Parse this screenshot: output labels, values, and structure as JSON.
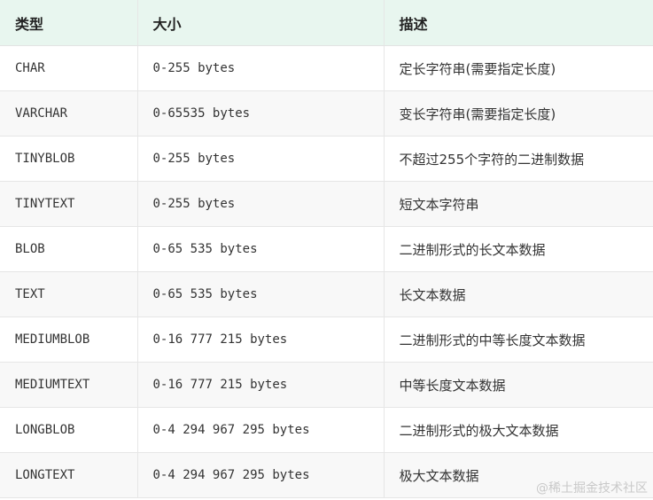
{
  "table": {
    "headers": [
      "类型",
      "大小",
      "描述"
    ],
    "rows": [
      {
        "type": "CHAR",
        "size": "0-255 bytes",
        "desc": "定长字符串(需要指定长度)"
      },
      {
        "type": "VARCHAR",
        "size": "0-65535 bytes",
        "desc": "变长字符串(需要指定长度)"
      },
      {
        "type": "TINYBLOB",
        "size": "0-255 bytes",
        "desc": "不超过255个字符的二进制数据"
      },
      {
        "type": "TINYTEXT",
        "size": "0-255 bytes",
        "desc": "短文本字符串"
      },
      {
        "type": "BLOB",
        "size": "0-65 535 bytes",
        "desc": "二进制形式的长文本数据"
      },
      {
        "type": "TEXT",
        "size": "0-65 535 bytes",
        "desc": "长文本数据"
      },
      {
        "type": "MEDIUMBLOB",
        "size": "0-16 777 215 bytes",
        "desc": "二进制形式的中等长度文本数据"
      },
      {
        "type": "MEDIUMTEXT",
        "size": "0-16 777 215 bytes",
        "desc": "中等长度文本数据"
      },
      {
        "type": "LONGBLOB",
        "size": "0-4 294 967 295 bytes",
        "desc": "二进制形式的极大文本数据"
      },
      {
        "type": "LONGTEXT",
        "size": "0-4 294 967 295 bytes",
        "desc": "极大文本数据"
      }
    ]
  },
  "watermark": "@稀土掘金技术社区"
}
